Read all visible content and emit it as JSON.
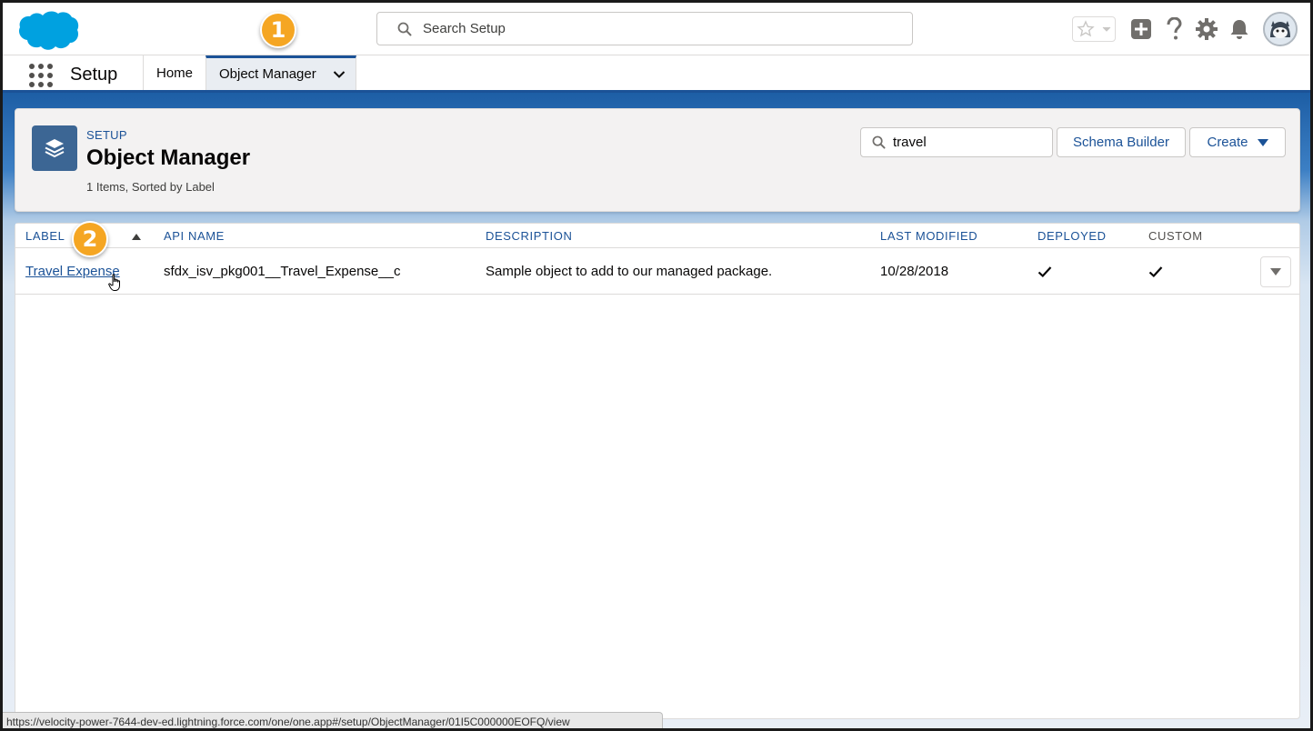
{
  "global_header": {
    "search_placeholder": "Search Setup"
  },
  "context_bar": {
    "app_name": "Setup",
    "tabs": [
      {
        "label": "Home"
      },
      {
        "label": "Object Manager"
      }
    ]
  },
  "page_header": {
    "eyebrow": "SETUP",
    "title": "Object Manager",
    "meta": "1 Items, Sorted by Label",
    "quickfind_value": "travel",
    "schema_builder_label": "Schema Builder",
    "create_label": "Create"
  },
  "table": {
    "columns": [
      "LABEL",
      "API NAME",
      "DESCRIPTION",
      "LAST MODIFIED",
      "DEPLOYED",
      "CUSTOM"
    ],
    "rows": [
      {
        "label": "Travel Expense",
        "api_name": "sfdx_isv_pkg001__Travel_Expense__c",
        "description": "Sample object to add to our managed package.",
        "last_modified": "10/28/2018",
        "deployed": true,
        "custom": true
      }
    ]
  },
  "badges": {
    "step1": "1",
    "step2": "2"
  },
  "status_bar": {
    "url": "https://velocity-power-7644-dev-ed.lightning.force.com/one/one.app#/setup/ObjectManager/01I5C000000EOFQ/view"
  },
  "colors": {
    "brand_blue": "#1b5297",
    "badge_orange": "#f5a623",
    "cloud_blue": "#00a1e0"
  }
}
